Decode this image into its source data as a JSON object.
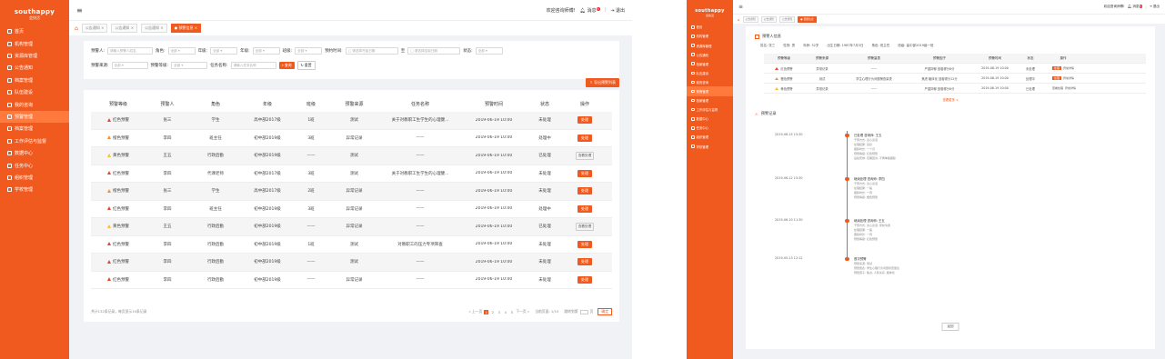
{
  "brand": {
    "logo_main": "southappy",
    "logo_sub": "会快活",
    "accent": "#f05a1e"
  },
  "header": {
    "welcome": "欢迎咨询师傅!",
    "messages": "消息",
    "messages_badge": "5",
    "logout": "退出"
  },
  "sidebar1": [
    "首页",
    "机构管理",
    "资源库管理",
    "公告通知",
    "档案管理",
    "队伍建设",
    "我的咨询",
    "预警管理",
    "档案管理",
    "工作评估与监督",
    "数据中心",
    "任务中心",
    "组织管理",
    "学校管理"
  ],
  "sidebar2": [
    "首页",
    "机构管理",
    "资源库管理",
    "公告通知",
    "档案管理",
    "队伍建设",
    "我的咨询",
    "预警管理",
    "档案管理",
    "工作评估与监督",
    "数据中心",
    "任务中心",
    "组织管理",
    "学校管理"
  ],
  "tabs1": [
    "公告通知 ×",
    "公告通知 ×",
    "公告通知 ×",
    "● 预警信息 ×"
  ],
  "tabs2": [
    "公告通知",
    "公告通知",
    "公告通知",
    "● 预警信息"
  ],
  "filters": {
    "warner_label": "预警人:",
    "warner_ph": "请输入预警人姓名",
    "role_label": "角色:",
    "role_val": "全部",
    "grade_label": "年级:",
    "grade_val": "全部",
    "level_label": "年级:",
    "level_val": "全部",
    "class_label": "班级:",
    "class_val": "全部",
    "time_label": "预约时间:",
    "time_start": "请选择开始日期",
    "time_to": "至",
    "time_end": "请选择结束日期",
    "status_label": "状态:",
    "status_val": "全部",
    "source_label": "预警来源:",
    "source_val": "全部",
    "wlevel_label": "预警等级:",
    "wlevel_val": "全部",
    "task_label": "任务名称:",
    "task_ph": "请输入任务名称",
    "query": "查询",
    "reset": "重置"
  },
  "export_button": "导出预警列表",
  "table": {
    "headers": [
      "预警等级",
      "预警人",
      "角色",
      "年级",
      "班级",
      "预警来源",
      "任务名称",
      "预警时间",
      "状态",
      "操作"
    ],
    "rows": [
      {
        "level": "红色预警",
        "color": "#e8442a",
        "person": "张三",
        "role": "学生",
        "grade": "高中部2017级",
        "cls": "1班",
        "src": "测试",
        "task": "关于对教职工生学生的心理健...",
        "time": "2019-06-19 10:00",
        "status": "未处理",
        "op": "处理",
        "op_type": "btn"
      },
      {
        "level": "橙色预警",
        "color": "#f5902a",
        "person": "李四",
        "role": "班主任",
        "grade": "初中部2019级",
        "cls": "3班",
        "src": "异常记录",
        "task": "——",
        "time": "2019-06-19 10:00",
        "status": "处理中",
        "op": "处理",
        "op_type": "btn"
      },
      {
        "level": "黄色预警",
        "color": "#f5c22a",
        "person": "王五",
        "role": "行政后勤",
        "grade": "初中部2019级",
        "cls": "——",
        "src": "测试",
        "task": "——",
        "time": "2019-06-19 10:00",
        "status": "已处理",
        "op": "查看处理",
        "op_type": "link"
      },
      {
        "level": "红色预警",
        "color": "#e8442a",
        "person": "李四",
        "role": "代课老师",
        "grade": "初中部2017级",
        "cls": "3班",
        "src": "测试",
        "task": "关于对教职工生学生的心理健...",
        "time": "2019-06-19 10:00",
        "status": "未处理",
        "op": "处理",
        "op_type": "btn"
      },
      {
        "level": "橙色预警",
        "color": "#f5902a",
        "person": "张三",
        "role": "学生",
        "grade": "高中部2017级",
        "cls": "2班",
        "src": "异常记录",
        "task": "——",
        "time": "2019-06-19 10:00",
        "status": "未处理",
        "op": "处理",
        "op_type": "btn"
      },
      {
        "level": "红色预警",
        "color": "#e8442a",
        "person": "李四",
        "role": "班主任",
        "grade": "初中部2019级",
        "cls": "3班",
        "src": "异常记录",
        "task": "——",
        "time": "2019-06-19 10:00",
        "status": "处理中",
        "op": "处理",
        "op_type": "btn"
      },
      {
        "level": "黄色预警",
        "color": "#f5c22a",
        "person": "王五",
        "role": "行政后勤",
        "grade": "初中部2019级",
        "cls": "——",
        "src": "异常记录",
        "task": "——",
        "time": "2019-06-19 10:00",
        "status": "已处理",
        "op": "查看处理",
        "op_type": "link"
      },
      {
        "level": "红色预警",
        "color": "#e8442a",
        "person": "李四",
        "role": "行政后勤",
        "grade": "初中部2019级",
        "cls": "1班",
        "src": "测试",
        "task": "对教职工的压力专项筛查",
        "time": "2019-06-19 10:00",
        "status": "未处理",
        "op": "处理",
        "op_type": "btn"
      },
      {
        "level": "红色预警",
        "color": "#e8442a",
        "person": "李四",
        "role": "行政后勤",
        "grade": "初中部2019级",
        "cls": "——",
        "src": "测试",
        "task": "——",
        "time": "2019-06-19 10:00",
        "status": "未处理",
        "op": "处理",
        "op_type": "btn"
      },
      {
        "level": "红色预警",
        "color": "#e8442a",
        "person": "李四",
        "role": "行政后勤",
        "grade": "初中部2019级",
        "cls": "——",
        "src": "异常记录",
        "task": "——",
        "time": "2019-06-19 10:00",
        "status": "未处理",
        "op": "处理",
        "op_type": "btn"
      }
    ]
  },
  "pager": {
    "summary": "共计132条记录，每页显示10条记录",
    "prev": "« 上一页",
    "pages": [
      "1",
      "2",
      "3",
      "4",
      "5"
    ],
    "next": "下一页 »",
    "current": "当前页面: 1/15",
    "goto": "跳转到第",
    "page_unit": "页",
    "go": "确定"
  },
  "detail": {
    "person_title": "预警人信息",
    "info": [
      "姓名: 张三",
      "性别: 男",
      "年龄: 32岁",
      "出生日期: 1987年7月3日",
      "角色: 班主任",
      "班级: 高中部2019级一班"
    ],
    "mini_headers": [
      "预警等级",
      "预警来源",
      "预警量表",
      "预警因子",
      "预警时间",
      "状态",
      "操作"
    ],
    "mini_rows": [
      {
        "level": "红色预警",
        "color": "#e8442a",
        "src": "异常记录",
        "scale": "——",
        "factor": "严重抑郁 回卷得分8分",
        "time": "2019-06-19 10:00",
        "status": "未处理",
        "op": "处理",
        "link": "异常详情"
      },
      {
        "level": "橙色预警",
        "color": "#f5902a",
        "src": "测试",
        "scale": "学生心理行为问题筛查量表",
        "factor": "焦虑 躯体化 回卷得分12分",
        "time": "2019-06-19 10:00",
        "status": "处理中",
        "op": "处理",
        "link": "异常详情"
      },
      {
        "level": "黄色预警",
        "color": "#f5c22a",
        "src": "异常记录",
        "scale": "——",
        "factor": "严重抑郁 回卷得分8分",
        "time": "2019-06-19 10:00",
        "status": "已处理",
        "op": "查看处理",
        "link": "异常详情"
      }
    ],
    "more": "查看更多 ∨",
    "record_title": "预警记录",
    "events": [
      {
        "time": "2019-06-15 15:30",
        "title": "已处理  咨询师: 王五",
        "lines": [
          "干预方式: 谈心谈话",
          "处理结果: 良好",
          "跟踪时长: 一个月",
          "预警等级: 红色预警",
          "后续安排: 定期回访, 不再单独跟踪"
        ]
      },
      {
        "time": "2019-06-12 15:30",
        "title": "继续处理  咨询师: 李四",
        "lines": [
          "干预方式: 谈心谈话",
          "处理结果: 一般",
          "跟踪时长: 一周",
          "预警等级: 橙色预警"
        ]
      },
      {
        "time": "2019-06-10 11:30",
        "title": "继续处理  咨询师: 王五",
        "lines": [
          "干预方式: 谈心谈话, 家校沟通",
          "处理结果: 一般",
          "跟踪时长: 一周",
          "预警等级: 红色预警"
        ]
      },
      {
        "time": "2019-05-13 12:12",
        "title": "首次预警",
        "lines": [
          "预警来源: 测试",
          "预警量表: 学生心理行为问题筛查量表",
          "预警因子: 焦虑, 人际关系, 躯体化"
        ]
      }
    ],
    "back": "返回"
  }
}
